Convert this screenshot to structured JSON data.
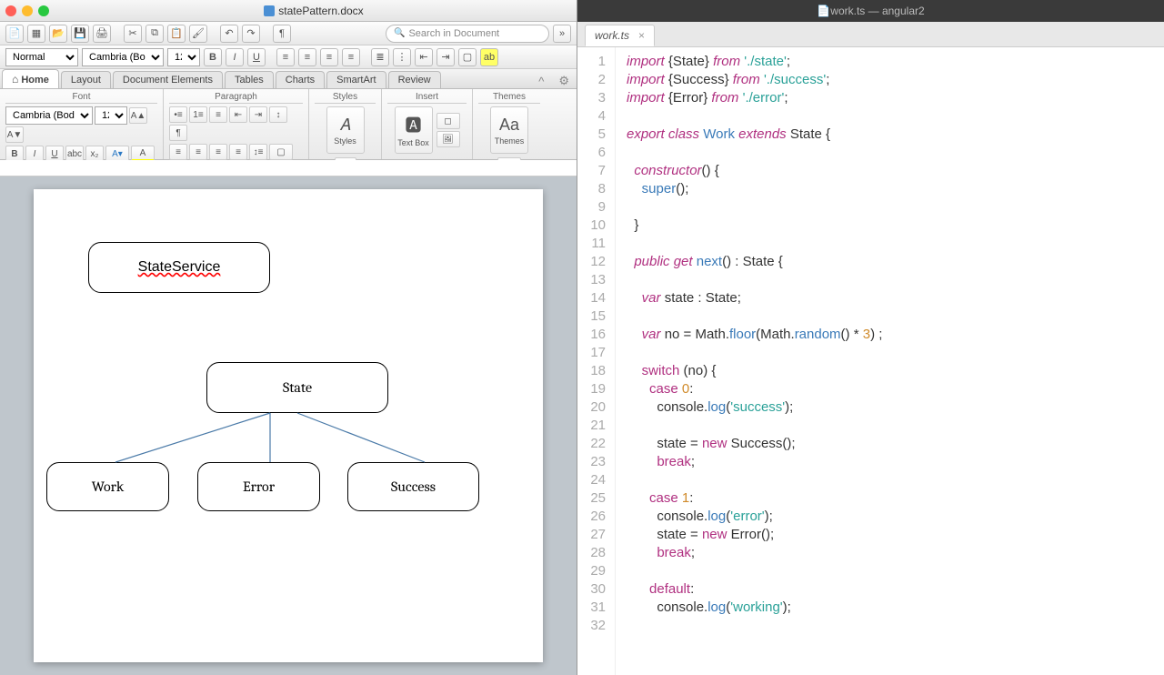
{
  "word": {
    "docname": "statePattern.docx",
    "search_placeholder": "Search in Document",
    "style_select": "Normal",
    "font_select": "Cambria (Bo...",
    "size_select": "12",
    "font_select2": "Cambria (Body)",
    "size_select2": "12",
    "tabs": [
      "Home",
      "Layout",
      "Document Elements",
      "Tables",
      "Charts",
      "SmartArt",
      "Review"
    ],
    "groups": {
      "font": "Font",
      "paragraph": "Paragraph",
      "styles": "Styles",
      "insert": "Insert",
      "themes": "Themes"
    },
    "big": {
      "styles": "Styles",
      "textbox": "Text Box",
      "themes": "Themes"
    },
    "diagram": {
      "stateService": "StateService",
      "state": "State",
      "work": "Work",
      "error": "Error",
      "success": "Success"
    }
  },
  "editor": {
    "title": "work.ts — angular2",
    "tab": "work.ts",
    "lines": [
      {
        "n": 1,
        "html": "<span class='kw'>import</span> {<span class='ty'>State</span>} <span class='kw'>from</span> <span class='str'>'./state'</span>;"
      },
      {
        "n": 2,
        "html": "<span class='kw'>import</span> {<span class='ty'>Success</span>} <span class='kw'>from</span> <span class='str'>'./success'</span>;"
      },
      {
        "n": 3,
        "html": "<span class='kw'>import</span> {<span class='ty'>Error</span>} <span class='kw'>from</span> <span class='str'>'./error'</span>;"
      },
      {
        "n": 4,
        "html": ""
      },
      {
        "n": 5,
        "html": "<span class='kw'>export</span> <span class='kw'>class</span> <span class='fn'>Work</span> <span class='kw'>extends</span> <span class='ty'>State</span> {"
      },
      {
        "n": 6,
        "html": ""
      },
      {
        "n": 7,
        "html": "  <span class='kw'>constructor</span>() {"
      },
      {
        "n": 8,
        "html": "    <span class='fn'>super</span>();"
      },
      {
        "n": 9,
        "html": ""
      },
      {
        "n": 10,
        "html": "  }"
      },
      {
        "n": 11,
        "html": ""
      },
      {
        "n": 12,
        "html": "  <span class='kw'>public</span> <span class='kw'>get</span> <span class='fn'>next</span>() : <span class='ty'>State</span> {"
      },
      {
        "n": 13,
        "html": ""
      },
      {
        "n": 14,
        "html": "    <span class='kw'>var</span> <span class='id'>state</span> : <span class='ty'>State</span>;"
      },
      {
        "n": 15,
        "html": ""
      },
      {
        "n": 16,
        "html": "    <span class='kw'>var</span> <span class='id'>no</span> = Math.<span class='fn'>floor</span>(Math.<span class='fn'>random</span>() * <span class='num'>3</span>) ;"
      },
      {
        "n": 17,
        "html": ""
      },
      {
        "n": 18,
        "html": "    <span class='op'>switch</span> (no) {"
      },
      {
        "n": 19,
        "html": "      <span class='op'>case</span> <span class='num'>0</span>:"
      },
      {
        "n": 20,
        "html": "        console.<span class='fn'>log</span>(<span class='str'>'success'</span>);"
      },
      {
        "n": 21,
        "html": ""
      },
      {
        "n": 22,
        "html": "        state = <span class='op'>new</span> <span class='ty'>Success</span>();"
      },
      {
        "n": 23,
        "html": "        <span class='op'>break</span>;"
      },
      {
        "n": 24,
        "html": ""
      },
      {
        "n": 25,
        "html": "      <span class='op'>case</span> <span class='num'>1</span>:"
      },
      {
        "n": 26,
        "html": "        console.<span class='fn'>log</span>(<span class='str'>'error'</span>);"
      },
      {
        "n": 27,
        "html": "        state = <span class='op'>new</span> <span class='ty'>Error</span>();"
      },
      {
        "n": 28,
        "html": "        <span class='op'>break</span>;"
      },
      {
        "n": 29,
        "html": ""
      },
      {
        "n": 30,
        "html": "      <span class='op'>default</span>:"
      },
      {
        "n": 31,
        "html": "        console.<span class='fn'>log</span>(<span class='str'>'working'</span>);"
      },
      {
        "n": 32,
        "html": ""
      }
    ]
  }
}
